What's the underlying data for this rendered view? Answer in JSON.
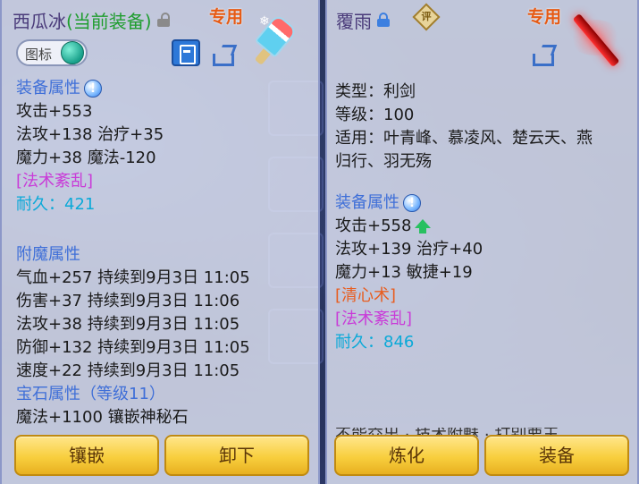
{
  "left": {
    "name": "西瓜冰",
    "equipped_tag": "(当前装备)",
    "exclusive": "专用",
    "icon_toggle_label": "图标",
    "attr_header": "装备属性",
    "stats": [
      "攻击+553",
      "法攻+138 治疗+35",
      "魔力+38 魔法-120"
    ],
    "skill": "[法术紊乱]",
    "durability": "耐久：421",
    "enchant_header": "附魔属性",
    "enchants": [
      "气血+257 持续到9月3日 11:05",
      "伤害+37 持续到9月3日 11:06",
      "法攻+38 持续到9月3日 11:05",
      "防御+132 持续到9月3日 11:05",
      "速度+22 持续到9月3日 11:05"
    ],
    "gem_header": "宝石属性（等级11）",
    "gem_stat": "魔法+1100 镶嵌神秘石",
    "buttons": [
      "镶嵌",
      "卸下"
    ]
  },
  "right": {
    "name": "覆雨",
    "rating": "评",
    "exclusive": "专用",
    "type_line": "类型：利剑",
    "level_line": "等级：100",
    "usable_line1": "适用：叶青峰、慕凌风、楚云天、燕",
    "usable_line2": "归行、羽无殇",
    "attr_header": "装备属性",
    "attack": "攻击+558",
    "stats": [
      "法攻+139 治疗+40",
      "魔力+13 敏捷+19"
    ],
    "skill1": "[清心术]",
    "skill2": "[法术紊乱]",
    "durability": "耐久：846",
    "cut_text": "不能交出 · 技术附魅 · 打别要王",
    "buttons": [
      "炼化",
      "装备"
    ]
  },
  "icons": [
    "lock-open-icon",
    "lock-closed-icon",
    "book-icon",
    "share-icon",
    "info-icon",
    "up-arrow-icon",
    "popsicle-weapon-icon",
    "red-blade-weapon-icon",
    "rating-badge-icon"
  ],
  "colors": {
    "header_blue": "#3f6fd8",
    "skill_purple": "#c93bd8",
    "durability_cyan": "#0aa9d8",
    "skill_orange": "#e85d20",
    "equipped_green": "#1f9d2f",
    "exclusive_orange": "#e65a14",
    "button_gold": "#f8cf3e"
  }
}
